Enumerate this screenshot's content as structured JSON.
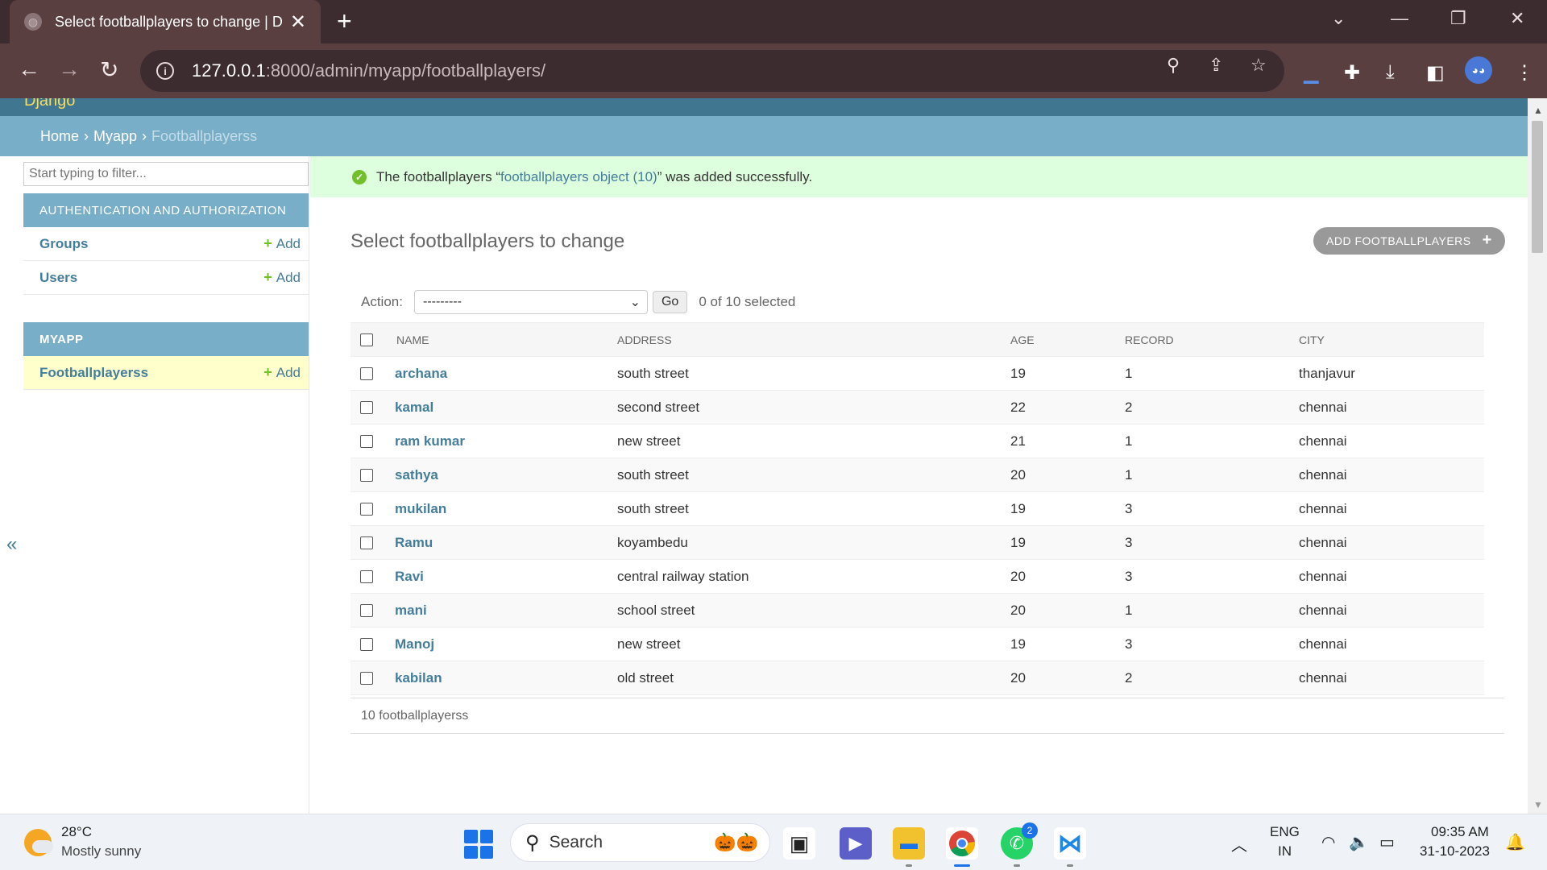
{
  "browser": {
    "tab_title": "Select footballplayers to change | D",
    "url_host": "127.0.0.1",
    "url_rest": ":8000/admin/myapp/footballplayers/"
  },
  "header": {
    "site_name_partial": "Django"
  },
  "breadcrumbs": {
    "home": "Home",
    "app": "Myapp",
    "current": "Footballplayerss"
  },
  "sidebar": {
    "filter_placeholder": "Start typing to filter...",
    "auth_caption": "AUTHENTICATION AND AUTHORIZATION",
    "auth_items": [
      {
        "label": "Groups",
        "add": "Add"
      },
      {
        "label": "Users",
        "add": "Add"
      }
    ],
    "app_caption": "MYAPP",
    "app_items": [
      {
        "label": "Footballplayerss",
        "add": "Add"
      }
    ],
    "collapse_label": "«"
  },
  "message": {
    "prefix": "The footballplayers “",
    "object": "footballplayers object (10)",
    "suffix": "” was added successfully."
  },
  "content": {
    "title": "Select footballplayers to change",
    "add_button": "ADD FOOTBALLPLAYERS"
  },
  "actions": {
    "label": "Action:",
    "selected_value": "---------",
    "go_label": "Go",
    "counter": "0 of 10 selected"
  },
  "table": {
    "columns": [
      "NAME",
      "ADDRESS",
      "AGE",
      "RECORD",
      "CITY"
    ],
    "rows": [
      {
        "name": "archana",
        "address": "south street",
        "age": "19",
        "record": "1",
        "city": "thanjavur"
      },
      {
        "name": "kamal",
        "address": "second street",
        "age": "22",
        "record": "2",
        "city": "chennai"
      },
      {
        "name": "ram kumar",
        "address": "new street",
        "age": "21",
        "record": "1",
        "city": "chennai"
      },
      {
        "name": "sathya",
        "address": "south street",
        "age": "20",
        "record": "1",
        "city": "chennai"
      },
      {
        "name": "mukilan",
        "address": "south street",
        "age": "19",
        "record": "3",
        "city": "chennai"
      },
      {
        "name": "Ramu",
        "address": "koyambedu",
        "age": "19",
        "record": "3",
        "city": "chennai"
      },
      {
        "name": "Ravi",
        "address": "central railway station",
        "age": "20",
        "record": "3",
        "city": "chennai"
      },
      {
        "name": "mani",
        "address": "school street",
        "age": "20",
        "record": "1",
        "city": "chennai"
      },
      {
        "name": "Manoj",
        "address": "new street",
        "age": "19",
        "record": "3",
        "city": "chennai"
      },
      {
        "name": "kabilan",
        "address": "old street",
        "age": "20",
        "record": "2",
        "city": "chennai"
      }
    ]
  },
  "paginator": {
    "text": "10 footballplayerss"
  },
  "taskbar": {
    "weather_temp": "28°C",
    "weather_desc": "Mostly sunny",
    "search_label": "Search",
    "whatsapp_badge": "2",
    "lang_top": "ENG",
    "lang_bottom": "IN",
    "time": "09:35 AM",
    "date": "31-10-2023"
  },
  "colors": {
    "django_header": "#417690",
    "breadcrumb_bar": "#79aec8",
    "success_bg": "#ddffdd",
    "link": "#447e9b",
    "add_green": "#70bf2b",
    "chrome_frame": "#3c2b2f"
  }
}
